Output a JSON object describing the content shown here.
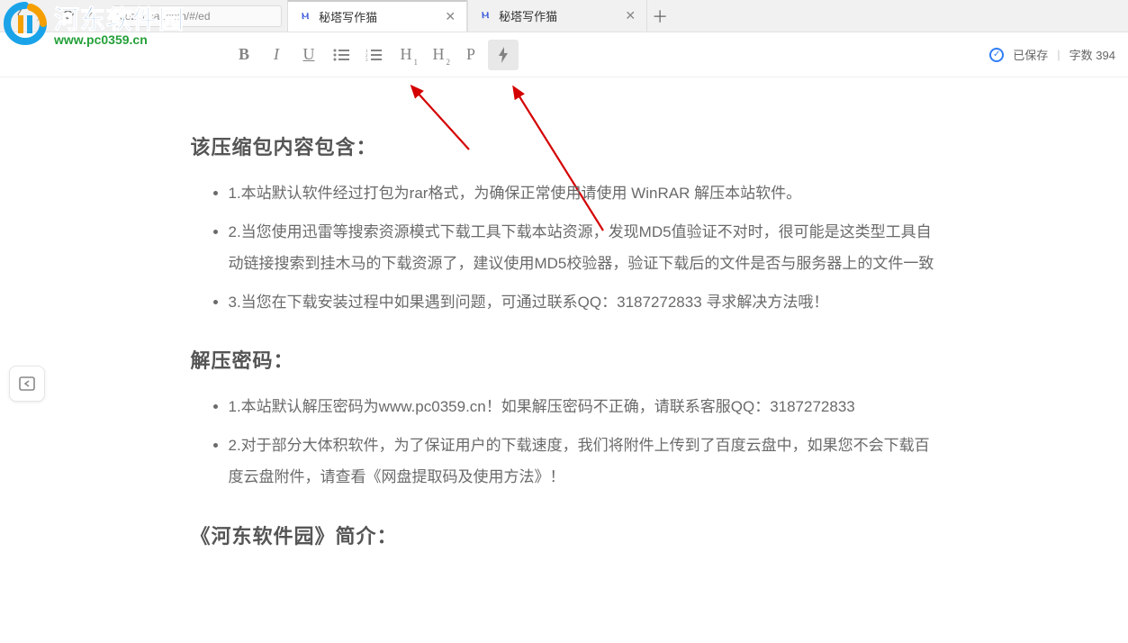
{
  "browser": {
    "url": "xiezuocat.com/#/ed",
    "tabs": [
      {
        "title": "秘塔写作猫",
        "active": true
      },
      {
        "title": "秘塔写作猫",
        "active": false
      }
    ]
  },
  "watermark": {
    "cn": "河东软件园",
    "url": "www.pc0359.cn"
  },
  "toolbar": {
    "bold": "B",
    "italic": "I",
    "underline": "U",
    "ul": "≡",
    "ol": "≡",
    "h1": "H",
    "h1_sub": "1",
    "h2": "H",
    "h2_sub": "2",
    "p": "P",
    "ai": "⚡"
  },
  "status": {
    "saved_label": "已保存",
    "wordcount_label": "字数",
    "wordcount_value": "394"
  },
  "document": {
    "sections": [
      {
        "heading": "该压缩包内容包含：",
        "items": [
          "1.本站默认软件经过打包为rar格式，为确保正常使用请使用 WinRAR 解压本站软件。",
          "2.当您使用迅雷等搜索资源模式下载工具下载本站资源，发现MD5值验证不对时，很可能是这类型工具自动链接搜索到挂木马的下载资源了，建议使用MD5校验器，验证下载后的文件是否与服务器上的文件一致",
          "3.当您在下载安装过程中如果遇到问题，可通过联系QQ：3187272833 寻求解决方法哦！"
        ]
      },
      {
        "heading": "解压密码：",
        "items": [
          "1.本站默认解压密码为www.pc0359.cn！如果解压密码不正确，请联系客服QQ：3187272833",
          "2.对于部分大体积软件，为了保证用户的下载速度，我们将附件上传到了百度云盘中，如果您不会下载百度云盘附件，请查看《网盘提取码及使用方法》！"
        ]
      },
      {
        "heading": "《河东软件园》简介：",
        "items": []
      }
    ]
  }
}
